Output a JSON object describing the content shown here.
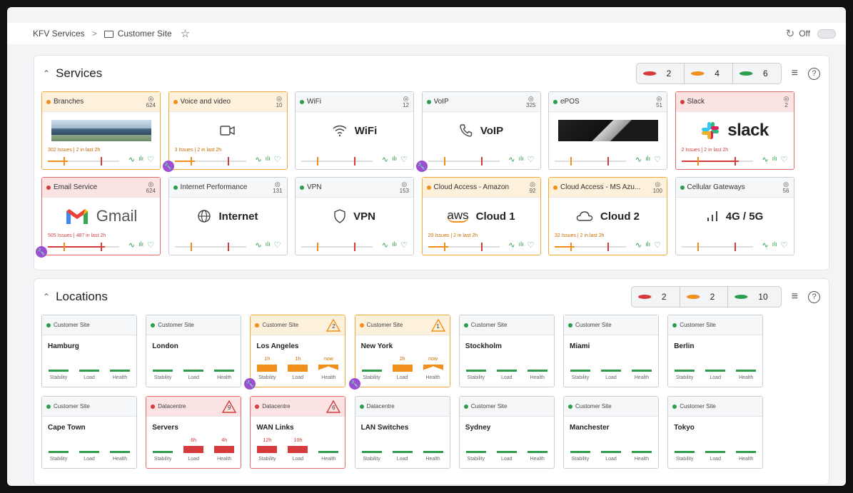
{
  "breadcrumb": {
    "root": "KFV Services",
    "sep": ">",
    "current": "Customer Site"
  },
  "auto_refresh": {
    "label": "Off"
  },
  "services": {
    "title": "Services",
    "counts": [
      {
        "n": "2",
        "color": "#d63a3a"
      },
      {
        "n": "4",
        "color": "#f0901a"
      },
      {
        "n": "6",
        "color": "#2e9d4b"
      }
    ],
    "cards": [
      {
        "name": "Branches",
        "views": "624",
        "status": "orange",
        "content": "image",
        "issues": "302 Issues | 2 in last 2h"
      },
      {
        "name": "Voice and video",
        "views": "10",
        "status": "orange",
        "content": "icon-video",
        "issues": "3 Issues | 2 in last 2h"
      },
      {
        "name": "WiFi",
        "views": "12",
        "status": "green",
        "label": "WiFi",
        "content": "icon-wifi",
        "issues": ""
      },
      {
        "name": "VoIP",
        "views": "325",
        "status": "green",
        "label": "VoIP",
        "content": "icon-phone",
        "issues": ""
      },
      {
        "name": "ePOS",
        "views": "51",
        "status": "green",
        "content": "image",
        "issues": ""
      },
      {
        "name": "Slack",
        "views": "2",
        "status": "red",
        "label": "slack",
        "content": "logo-slack",
        "issues": "2 Issues | 2 in last 2h"
      },
      {
        "name": "Email Service",
        "views": "624",
        "status": "red",
        "label": "Gmail",
        "content": "logo-gmail",
        "issues": "505 Issues | 487 in last 2h"
      },
      {
        "name": "Internet Performance",
        "views": "131",
        "status": "green",
        "label": "Internet",
        "content": "icon-globe",
        "issues": ""
      },
      {
        "name": "VPN",
        "views": "153",
        "status": "green",
        "label": "VPN",
        "content": "icon-shield",
        "issues": ""
      },
      {
        "name": "Cloud Access - Amazon",
        "views": "92",
        "status": "orange",
        "label": "Cloud 1",
        "content": "logo-aws",
        "issues": "20 Issues | 2 in last 2h"
      },
      {
        "name": "Cloud Access - MS Azu...",
        "views": "100",
        "status": "orange",
        "label": "Cloud 2",
        "content": "icon-cloud",
        "issues": "32 Issues | 2 in last 2h"
      },
      {
        "name": "Cellular Gateways",
        "views": "56",
        "status": "green",
        "label": "4G / 5G",
        "content": "icon-signal",
        "issues": ""
      }
    ],
    "aws_text": "aws"
  },
  "locations": {
    "title": "Locations",
    "counts": [
      {
        "n": "2",
        "color": "#d63a3a"
      },
      {
        "n": "2",
        "color": "#f0901a"
      },
      {
        "n": "10",
        "color": "#2e9d4b"
      }
    ],
    "metric_labels": [
      "Stability",
      "Load",
      "Health"
    ],
    "cards": [
      {
        "type": "Customer Site",
        "name": "Hamburg",
        "status": "green",
        "alert": "",
        "ages": [
          "",
          "",
          ""
        ]
      },
      {
        "type": "Customer Site",
        "name": "London",
        "status": "green",
        "alert": "",
        "ages": [
          "",
          "",
          ""
        ]
      },
      {
        "type": "Customer Site",
        "name": "Los Angeles",
        "status": "orange",
        "alert": "2",
        "ages": [
          "1h",
          "1h",
          "now"
        ]
      },
      {
        "type": "Customer Site",
        "name": "New York",
        "status": "orange",
        "alert": "1",
        "ages": [
          "",
          "2h",
          "now"
        ]
      },
      {
        "type": "Customer Site",
        "name": "Stockholm",
        "status": "green",
        "alert": "",
        "ages": [
          "",
          "",
          ""
        ]
      },
      {
        "type": "Customer Site",
        "name": "Miami",
        "status": "green",
        "alert": "",
        "ages": [
          "",
          "",
          ""
        ]
      },
      {
        "type": "Customer Site",
        "name": "Berlin",
        "status": "green",
        "alert": "",
        "ages": [
          "",
          "",
          ""
        ]
      },
      {
        "type": "Customer Site",
        "name": "Cape Town",
        "status": "green",
        "alert": "",
        "ages": [
          "",
          "",
          ""
        ]
      },
      {
        "type": "Datacentre",
        "name": "Servers",
        "status": "red",
        "alert": "9",
        "ages": [
          "",
          "6h",
          "4h"
        ]
      },
      {
        "type": "Datacentre",
        "name": "WAN Links",
        "status": "red",
        "alert": "6",
        "ages": [
          "12h",
          "10h",
          ""
        ]
      },
      {
        "type": "Datacentre",
        "name": "LAN Switches",
        "status": "green",
        "alert": "",
        "ages": [
          "",
          "",
          ""
        ]
      },
      {
        "type": "Customer Site",
        "name": "Sydney",
        "status": "green",
        "alert": "",
        "ages": [
          "",
          "",
          ""
        ]
      },
      {
        "type": "Customer Site",
        "name": "Manchester",
        "status": "green",
        "alert": "",
        "ages": [
          "",
          "",
          ""
        ]
      },
      {
        "type": "Customer Site",
        "name": "Tokyo",
        "status": "green",
        "alert": "",
        "ages": [
          "",
          "",
          ""
        ]
      }
    ]
  },
  "colors": {
    "green": "#2e9d4b",
    "orange": "#f0901a",
    "red": "#d63a3a",
    "maintenance": "#9c4dd1"
  }
}
